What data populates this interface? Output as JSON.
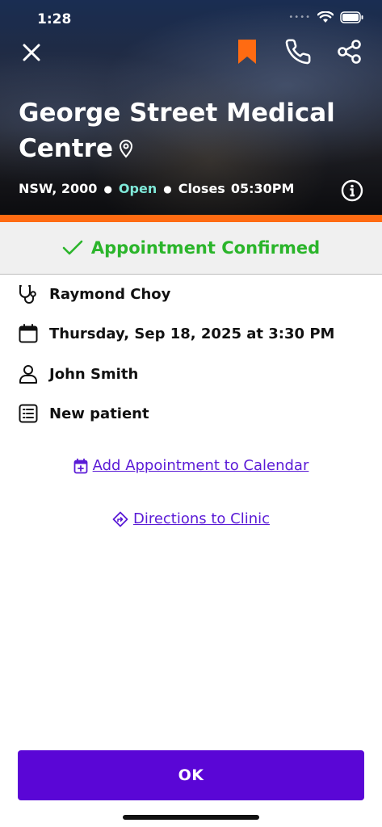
{
  "status_bar": {
    "time": "1:28"
  },
  "header": {
    "clinic_name": "George Street Medical Centre",
    "location": "NSW, 2000",
    "open_status": "Open",
    "closes_label": "Closes",
    "closes_time": "05:30PM",
    "bookmark_color": "#ff6b12"
  },
  "banner": {
    "text": "Appointment Confirmed",
    "color": "#2bb52b"
  },
  "details": {
    "doctor": "Raymond Choy",
    "datetime": "Thursday, Sep 18, 2025 at 3:30 PM",
    "patient": "John Smith",
    "visit_type": "New patient"
  },
  "links": {
    "calendar": "Add Appointment to Calendar",
    "directions": "Directions to Clinic"
  },
  "ok_button": {
    "label": "OK",
    "color": "#5a06d6"
  },
  "icons": [
    "close-icon",
    "bookmark-icon",
    "phone-icon",
    "share-icon",
    "location-pin-icon",
    "info-icon",
    "check-icon",
    "stethoscope-icon",
    "calendar-icon",
    "person-icon",
    "list-icon",
    "calendar-add-icon",
    "directions-icon"
  ]
}
